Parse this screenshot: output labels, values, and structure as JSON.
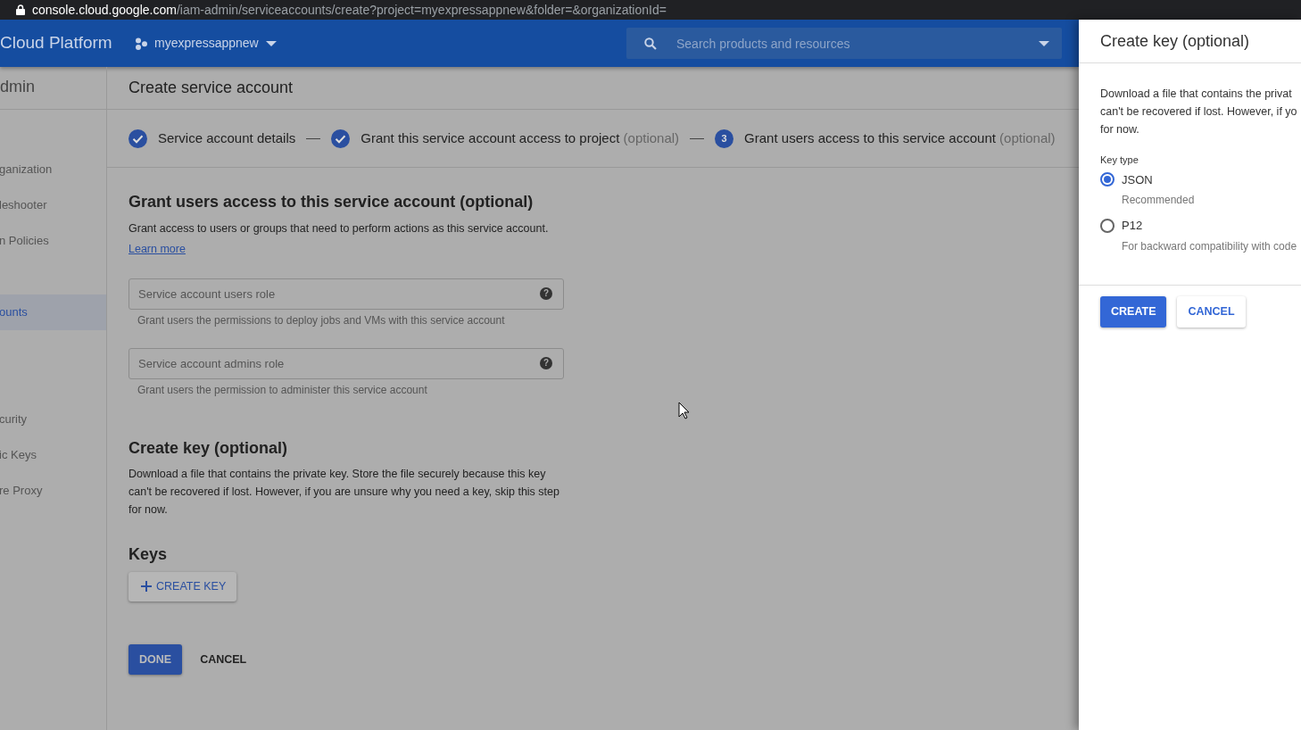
{
  "address_bar": {
    "host": "console.cloud.google.com",
    "path": "/iam-admin/serviceaccounts/create?project=myexpressappnew&folder=&organizationId="
  },
  "header": {
    "product": "Cloud Platform",
    "project": "myexpressappnew",
    "search": {
      "placeholder": "Search products and resources"
    }
  },
  "sidebar": {
    "title": "dmin",
    "groups": [
      {
        "items": [
          {
            "label": "ganization",
            "selected": false
          },
          {
            "label": "leshooter",
            "selected": false
          },
          {
            "label": "n Policies",
            "selected": false
          }
        ]
      },
      {
        "items": [
          {
            "label": "ounts",
            "selected": true
          }
        ]
      },
      {
        "items": [
          {
            "label": "curity",
            "selected": false
          },
          {
            "label": "ic Keys",
            "selected": false
          },
          {
            "label": "re Proxy",
            "selected": false
          }
        ]
      }
    ]
  },
  "page_title": "Create service account",
  "steps": [
    {
      "completed": true,
      "label": "Service account details"
    },
    {
      "completed": true,
      "label": "Grant this service account access to project",
      "suffix": "(optional)"
    },
    {
      "completed": false,
      "number": "3",
      "label": "Grant users access to this service account",
      "suffix": "(optional)"
    }
  ],
  "grant_section": {
    "title": "Grant users access to this service account (optional)",
    "description": "Grant access to users or groups that need to perform actions as this service account.",
    "link": "Learn more",
    "fields": [
      {
        "placeholder": "Service account users role",
        "help": "?",
        "hint": "Grant users the permissions to deploy jobs and VMs with this service account"
      },
      {
        "placeholder": "Service account admins role",
        "help": "?",
        "hint": "Grant users the permission to administer this service account"
      }
    ]
  },
  "key_section": {
    "title": "Create key (optional)",
    "description": "Download a file that contains the private key. Store the file securely because this key can't be recovered if lost. However, if you are unsure why you need a key, skip this step for now.",
    "keys_title": "Keys",
    "create_key_button": "CREATE KEY"
  },
  "actions": {
    "done": "DONE",
    "cancel": "CANCEL"
  },
  "drawer": {
    "title": "Create key (optional)",
    "description_lines": [
      "Download a file that contains the privat",
      "can't be recovered if lost. However, if yo",
      "for now."
    ],
    "key_type_label": "Key type",
    "options": [
      {
        "label": "JSON",
        "hint": "Recommended",
        "selected": true
      },
      {
        "label": "P12",
        "hint": "For backward compatibility with code",
        "selected": false
      }
    ],
    "create": "CREATE",
    "cancel": "CANCEL"
  }
}
